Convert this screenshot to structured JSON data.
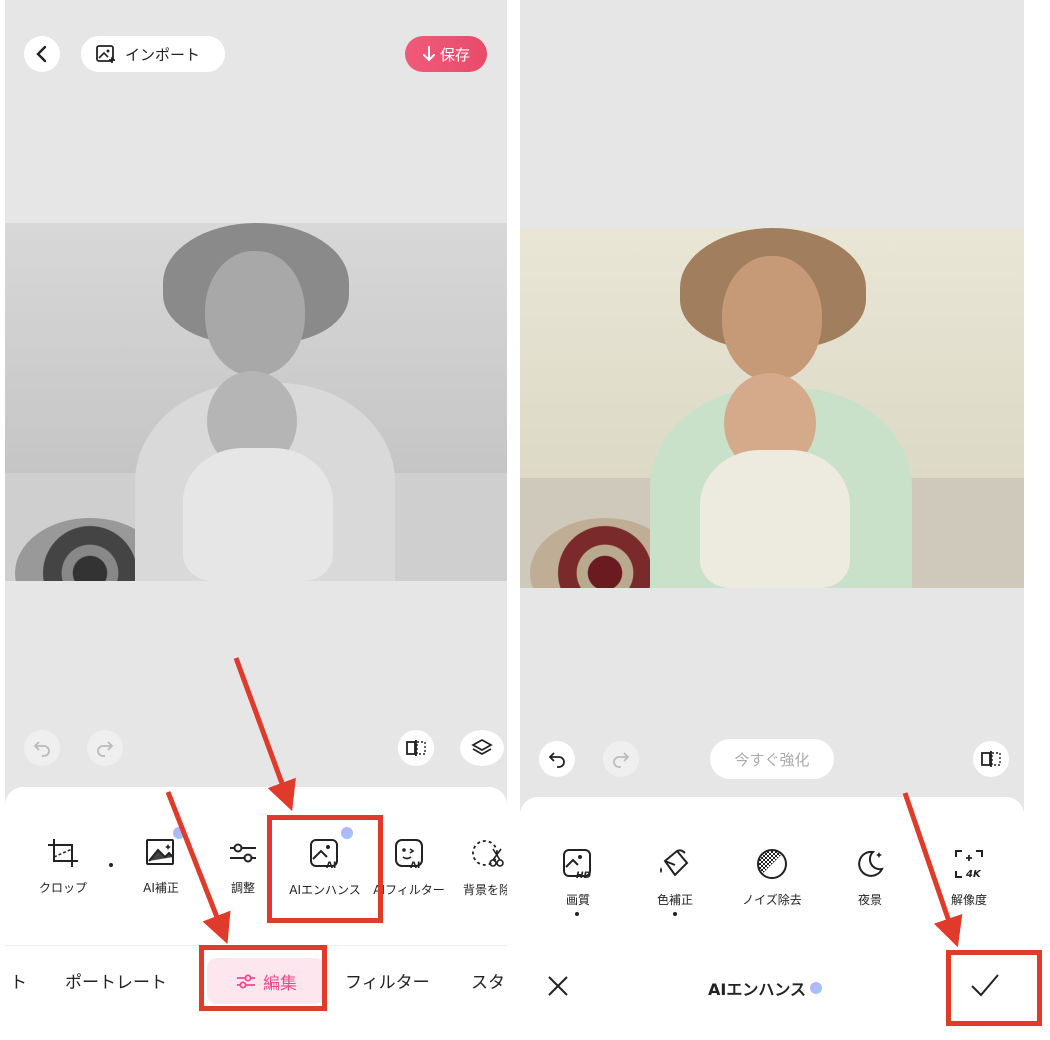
{
  "left": {
    "import_label": "インポート",
    "save_label": "保存",
    "tools": [
      {
        "label": "クロップ"
      },
      {
        "label": "AI補正"
      },
      {
        "label": "調整"
      },
      {
        "label": "AIエンハンス"
      },
      {
        "label": "AIフィルター"
      },
      {
        "label": "背景を除"
      }
    ],
    "tabs": [
      {
        "label": "ト"
      },
      {
        "label": "ポートレート"
      },
      {
        "label": "編集"
      },
      {
        "label": "フィルター"
      },
      {
        "label": "スタ"
      }
    ]
  },
  "right": {
    "enhance_now_label": "今すぐ強化",
    "tools": [
      {
        "label": "画質"
      },
      {
        "label": "色補正"
      },
      {
        "label": "ノイズ除去"
      },
      {
        "label": "夜景"
      },
      {
        "label": "解像度"
      }
    ],
    "footer_title": "AIエンハンス",
    "colors": {
      "accent": "#e94b8e",
      "annotation_red": "#e03a2a"
    }
  }
}
